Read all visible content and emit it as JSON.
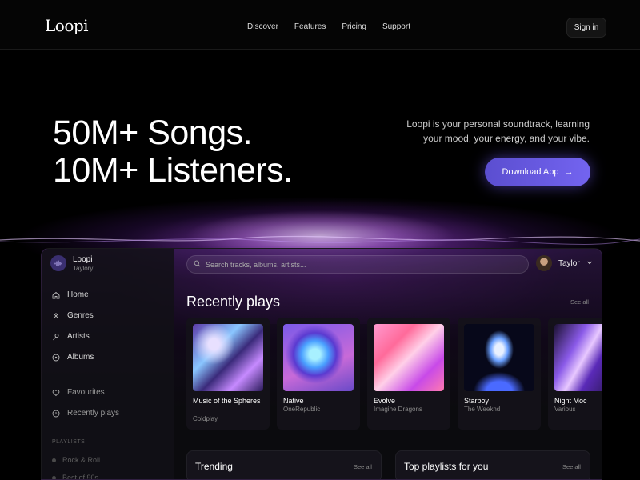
{
  "nav": {
    "logo": "Loopi",
    "links": [
      "Discover",
      "Features",
      "Pricing",
      "Support"
    ],
    "signin": "Sign in"
  },
  "hero": {
    "line1": "50M+ Songs.",
    "line2": "10M+ Listeners.",
    "desc_line1": "Loopi is your personal soundtrack, learning",
    "desc_line2": "your mood, your energy, and your vibe.",
    "cta": "Download App",
    "cta_icon": "arrow-right-icon"
  },
  "app": {
    "profile_name": "Loopi",
    "profile_sub": "Taylory",
    "menu": [
      {
        "label": "Home",
        "icon": "home-icon"
      },
      {
        "label": "Genres",
        "icon": "genres-icon"
      },
      {
        "label": "Artists",
        "icon": "artists-icon"
      },
      {
        "label": "Albums",
        "icon": "albums-icon"
      }
    ],
    "menu2": [
      {
        "label": "Favourites",
        "icon": "heart-icon"
      },
      {
        "label": "Recently plays",
        "icon": "clock-icon"
      }
    ],
    "playlists_heading": "PLAYLISTS",
    "playlists": [
      "Rock & Roll",
      "Best of 90s"
    ],
    "search_placeholder": "Search tracks, albums, artists...",
    "user_name": "Taylor",
    "recent_title": "Recently plays",
    "see_all": "See all",
    "cards": [
      {
        "title": "Music of the Spheres",
        "artist": "Coldplay"
      },
      {
        "title": "Native",
        "artist": "OneRepublic"
      },
      {
        "title": "Evolve",
        "artist": "Imagine Dragons"
      },
      {
        "title": "Starboy",
        "artist": "The Weeknd"
      },
      {
        "title": "Night Moc",
        "artist": "Various"
      }
    ],
    "trending_title": "Trending",
    "top_playlists_title": "Top playlists for you"
  }
}
